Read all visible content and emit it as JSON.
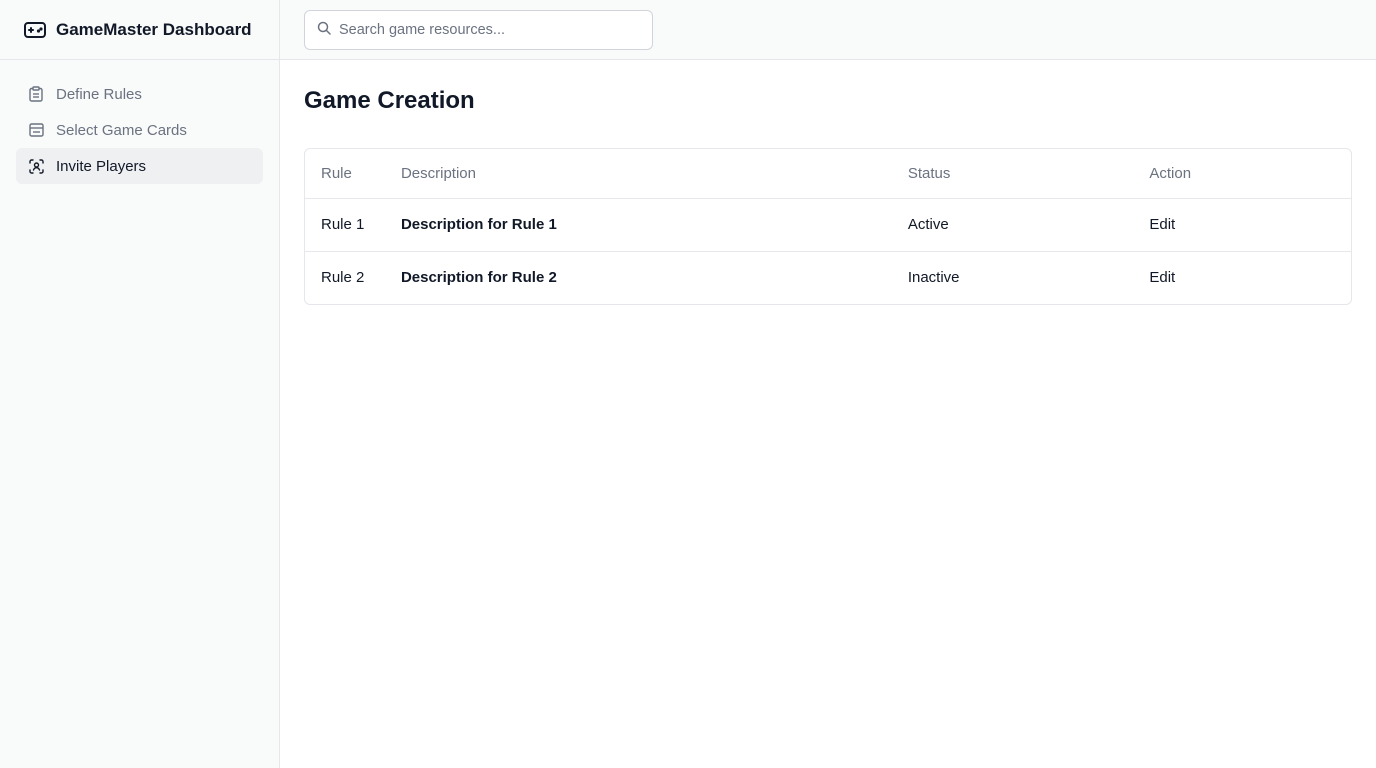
{
  "brand": {
    "title": "GameMaster Dashboard",
    "icon": "gamepad-icon"
  },
  "sidebar": {
    "items": [
      {
        "label": "Define Rules",
        "icon": "clipboard-icon",
        "active": false
      },
      {
        "label": "Select Game Cards",
        "icon": "card-stack-icon",
        "active": false
      },
      {
        "label": "Invite Players",
        "icon": "scan-user-icon",
        "active": true
      }
    ]
  },
  "search": {
    "placeholder": "Search game resources...",
    "value": ""
  },
  "main": {
    "title": "Game Creation",
    "table": {
      "headers": [
        "Rule",
        "Description",
        "Status",
        "Action"
      ],
      "rows": [
        {
          "rule": "Rule 1",
          "description": "Description for Rule 1",
          "status": "Active",
          "action": "Edit"
        },
        {
          "rule": "Rule 2",
          "description": "Description for Rule 2",
          "status": "Inactive",
          "action": "Edit"
        }
      ]
    }
  }
}
